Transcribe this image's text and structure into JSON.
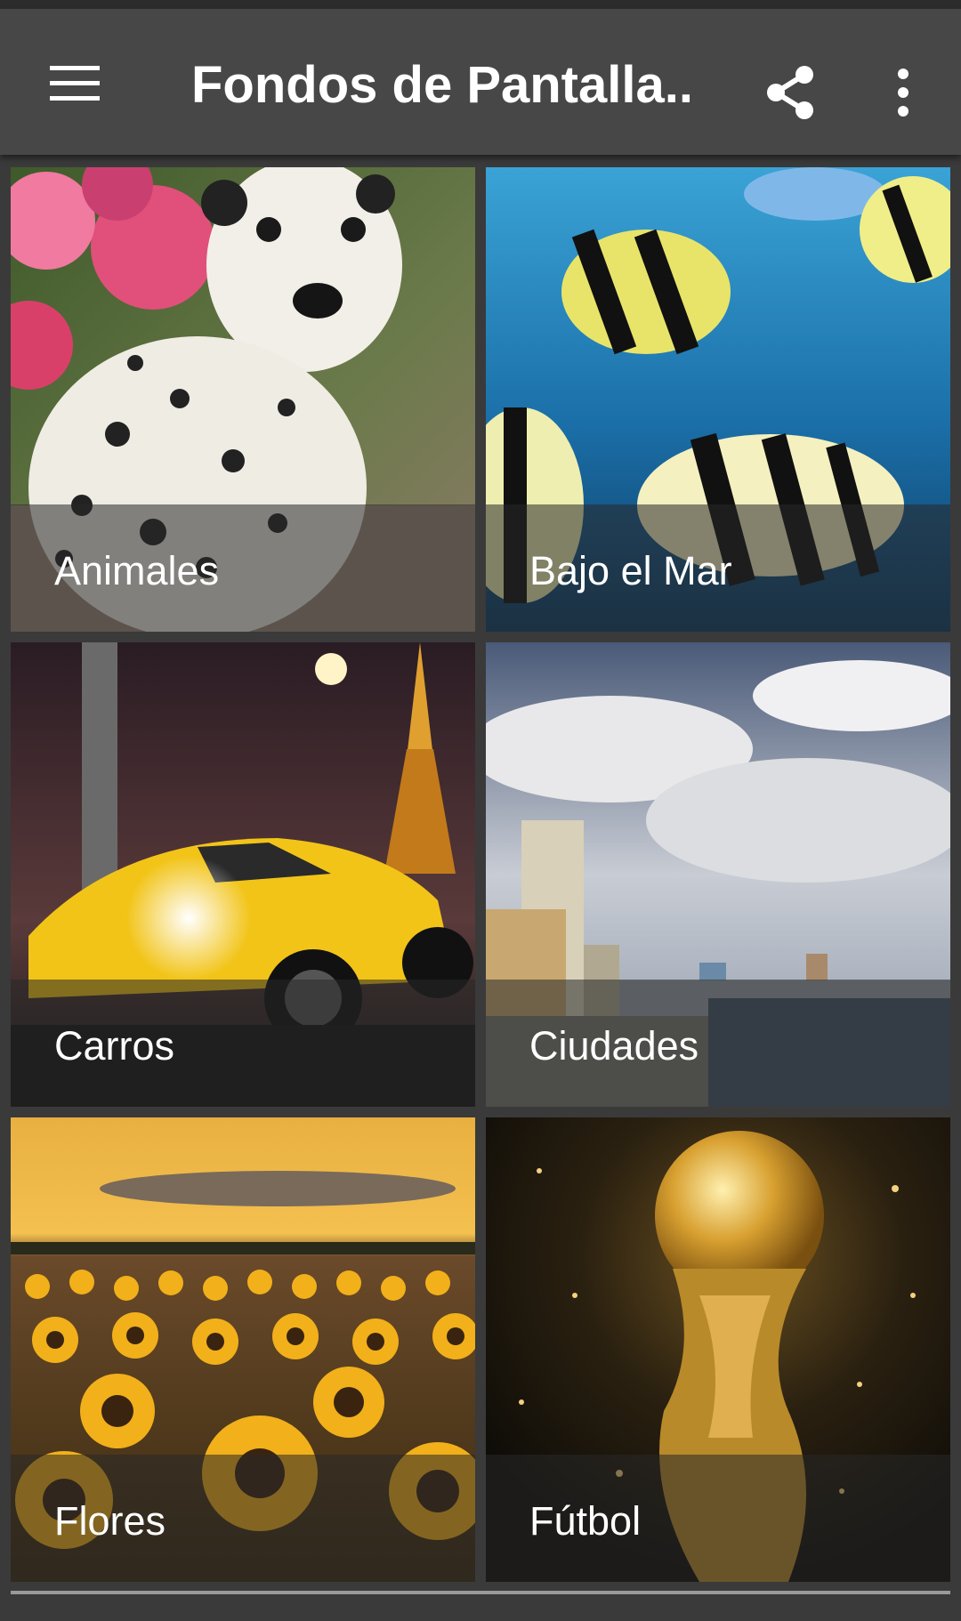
{
  "app": {
    "title": "Fondos de Pantalla...",
    "menu_icon": "menu-icon",
    "share_icon": "share-icon",
    "more_icon": "more-vert-icon",
    "appbar_color": "#474747",
    "text_color": "#ffffff"
  },
  "categories": [
    {
      "label": "Animales"
    },
    {
      "label": "Bajo el Mar"
    },
    {
      "label": "Carros"
    },
    {
      "label": "Ciudades"
    },
    {
      "label": "Flores"
    },
    {
      "label": "Fútbol"
    }
  ]
}
